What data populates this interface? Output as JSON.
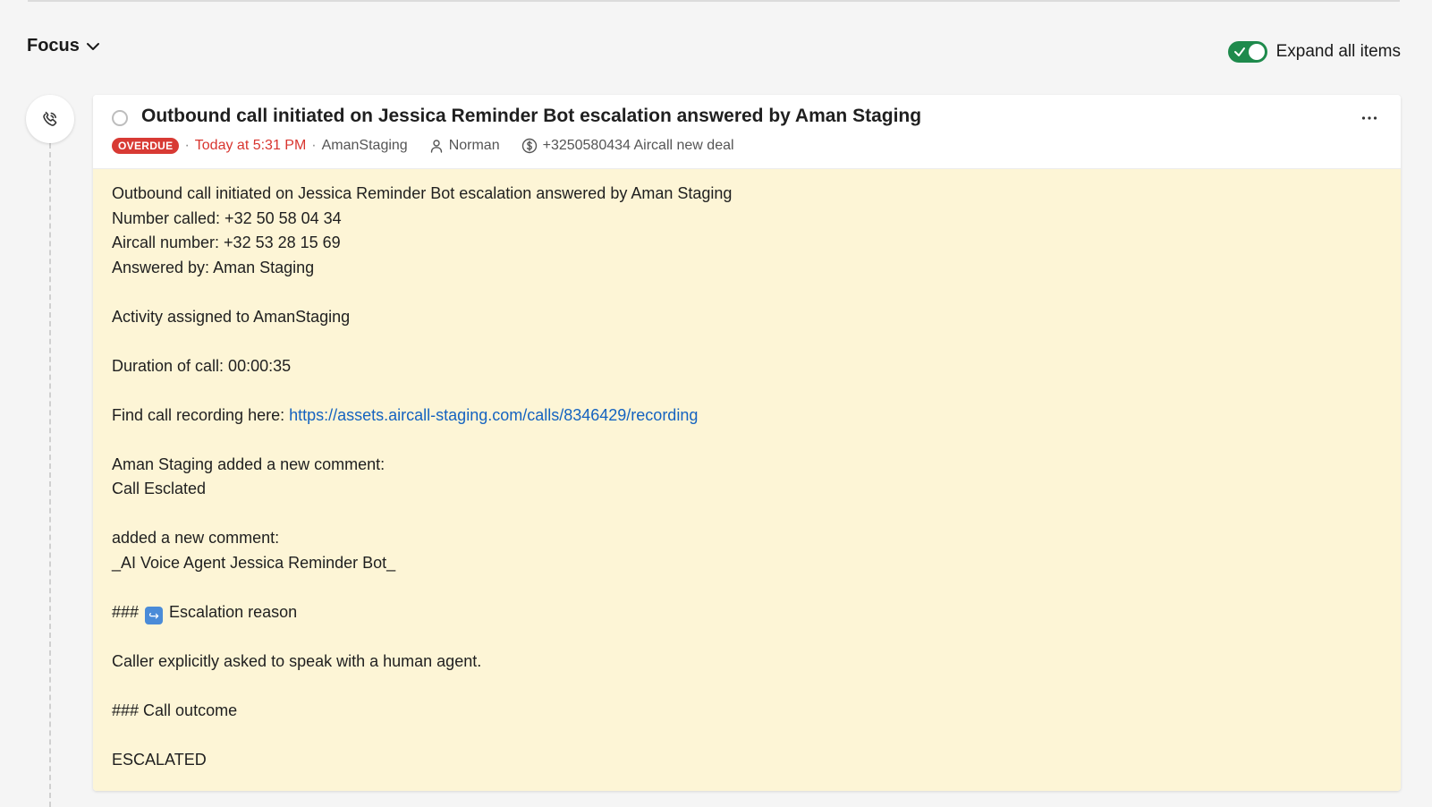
{
  "header": {
    "view_label": "Focus",
    "expand_label": "Expand all items",
    "expand_enabled": true,
    "toggle_color": "#1e8a4c"
  },
  "activity": {
    "type_icon": "phone-call-icon",
    "title": "Outbound call initiated on Jessica Reminder Bot escalation answered by Aman Staging",
    "status_badge": "OVERDUE",
    "due": "Today at 5:31 PM",
    "owner": "AmanStaging",
    "person": "Norman",
    "deal": "+3250580434 Aircall new deal",
    "badge_color": "#d83a34",
    "note_background": "#fdf5d6"
  },
  "note": {
    "line1": "Outbound call initiated on Jessica Reminder Bot escalation answered by Aman Staging",
    "line2": "Number called: +32 50 58 04 34",
    "line3": "Aircall number: +32 53 28 15 69",
    "line4": "Answered by: Aman Staging",
    "line5": "Activity assigned to AmanStaging",
    "line6": "Duration of call: 00:00:35",
    "recording_label": "Find call recording here: ",
    "recording_url": "https://assets.aircall-staging.com/calls/8346429/recording",
    "line8": "Aman Staging added a new comment:",
    "line9": "Call Esclated",
    "line10": "added a new comment:",
    "line11": "_AI Voice Agent Jessica Reminder Bot_",
    "line12_prefix": "### ",
    "line12_emoji": "↪",
    "line12_text": " Escalation reason",
    "line13": "Caller explicitly asked to speak with a human agent.",
    "line14": "### Call outcome",
    "line15": "ESCALATED"
  }
}
